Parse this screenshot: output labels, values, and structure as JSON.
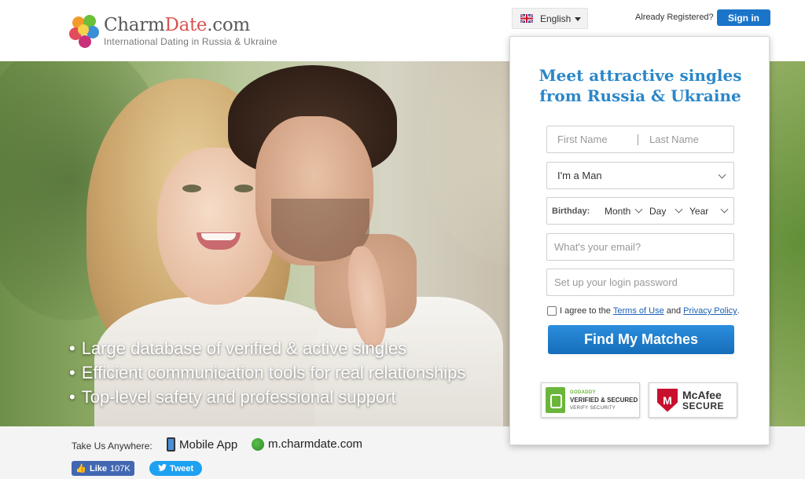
{
  "header": {
    "brand_part1": "Charm",
    "brand_part2": "Date",
    "brand_part3": ".com",
    "tagline": "International Dating in Russia & Ukraine",
    "language": "English",
    "already_registered": "Already Registered?",
    "sign_in": "Sign in"
  },
  "hero": {
    "bullets": [
      "Large database of verified & active singles",
      "Efficient communication tools for real relationships",
      "Top-level safety and professional support"
    ]
  },
  "signup": {
    "title_line1": "Meet attractive singles",
    "title_line2": "from Russia & Ukraine",
    "first_name_placeholder": "First Name",
    "last_name_placeholder": "Last Name",
    "gender_value": "I'm a Man",
    "birthday_label": "Birthday:",
    "month": "Month",
    "day": "Day",
    "year": "Year",
    "email_placeholder": "What's your email?",
    "password_placeholder": "Set up your login password",
    "agree_prefix": "I agree to the",
    "terms": "Terms of Use",
    "and": "and",
    "privacy": "Privacy Policy",
    "agree_suffix": ".",
    "submit": "Find My Matches"
  },
  "badges": {
    "godaddy_line1": "GODADDY",
    "godaddy_line2": "VERIFIED & SECURED",
    "godaddy_line3": "VERIFY SECURITY",
    "mcafee_line1": "McAfee",
    "mcafee_line2": "SECURE"
  },
  "footer": {
    "take_us": "Take Us Anywhere:",
    "mobile_app": "Mobile App",
    "mobile_site": "m.charmdate.com",
    "like": "Like",
    "like_count": "107K",
    "tweet": "Tweet"
  },
  "colors": {
    "accent_blue": "#1a75c9",
    "title_blue": "#2a87c9",
    "brand_red": "#d9534f",
    "facebook": "#4267b2",
    "twitter": "#1da1f2"
  }
}
